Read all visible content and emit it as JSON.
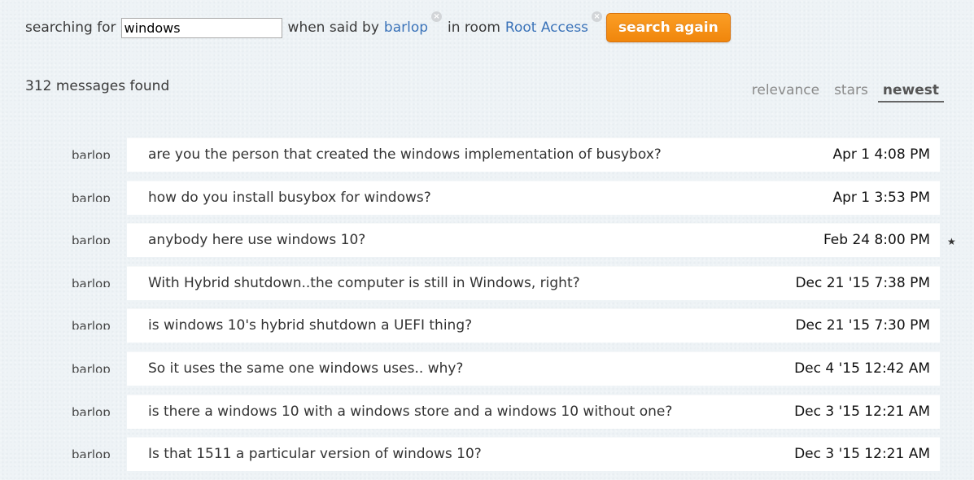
{
  "search": {
    "label_searching_for": "searching for",
    "query_value": "windows",
    "label_when_said_by": "when said by",
    "user_filter": "barlop",
    "label_in_room": "in room",
    "room_filter": "Root Access",
    "remove_icon": "×",
    "search_again_label": "search again"
  },
  "results": {
    "count_text": "312 messages found"
  },
  "sort": {
    "tabs": [
      {
        "label": "relevance",
        "active": false
      },
      {
        "label": "stars",
        "active": false
      },
      {
        "label": "newest",
        "active": true
      }
    ]
  },
  "messages": [
    {
      "user": "barlop",
      "text": "are you the person that created the windows implementation of busybox?",
      "time": "Apr 1 4:08 PM",
      "starred": false
    },
    {
      "user": "barlop",
      "text": "how do you install busybox for windows?",
      "time": "Apr 1 3:53 PM",
      "starred": false
    },
    {
      "user": "barlop",
      "text": "anybody here use windows 10?",
      "time": "Feb 24 8:00 PM",
      "starred": true,
      "star_glyph": "★"
    },
    {
      "user": "barlop",
      "text": "With Hybrid shutdown..the computer is still in Windows, right?",
      "time": "Dec 21 '15 7:38 PM",
      "starred": false
    },
    {
      "user": "barlop",
      "text": "is windows 10's hybrid shutdown a UEFI thing?",
      "time": "Dec 21 '15 7:30 PM",
      "starred": false
    },
    {
      "user": "barlop",
      "text": "So it uses the same one windows uses.. why?",
      "time": "Dec 4 '15 12:42 AM",
      "starred": false
    },
    {
      "user": "barlop",
      "text": "is there a windows 10 with a windows store and a windows 10 without one?",
      "time": "Dec 3 '15 12:21 AM",
      "starred": false
    },
    {
      "user": "barlop",
      "text": "Is that 1511 a particular version of windows 10?",
      "time": "Dec 3 '15 12:21 AM",
      "starred": false
    }
  ],
  "colors": {
    "accent_button": "#f58f13",
    "link": "#3b73b9",
    "background": "#eef3f6"
  }
}
